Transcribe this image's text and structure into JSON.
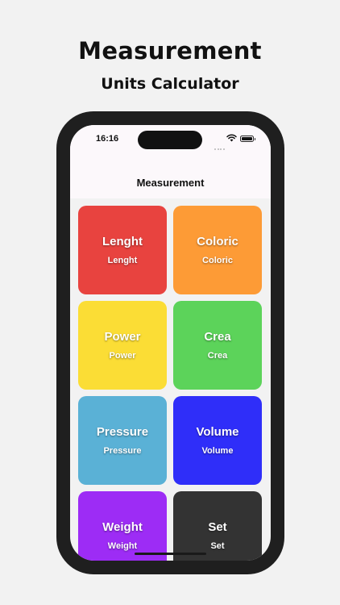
{
  "promo": {
    "title": "Measurement",
    "subtitle": "Units Calculator"
  },
  "status_bar": {
    "time": "16:16",
    "icons": [
      "signal-icon",
      "wifi-icon",
      "battery-icon"
    ]
  },
  "nav": {
    "title": "Measurement"
  },
  "tiles": [
    {
      "title": "Lenght",
      "subtitle": "Lenght",
      "color": "#e8433f"
    },
    {
      "title": "Coloric",
      "subtitle": "Coloric",
      "color": "#fd9b36"
    },
    {
      "title": "Power",
      "subtitle": "Power",
      "color": "#fbdd35"
    },
    {
      "title": "Crea",
      "subtitle": "Crea",
      "color": "#5cd35a"
    },
    {
      "title": "Pressure",
      "subtitle": "Pressure",
      "color": "#5ab1d6"
    },
    {
      "title": "Volume",
      "subtitle": "Volume",
      "color": "#2f2ef9"
    },
    {
      "title": "Weight",
      "subtitle": "Weight",
      "color": "#9d2cf5"
    },
    {
      "title": "Set",
      "subtitle": "Set",
      "color": "#333333"
    }
  ]
}
